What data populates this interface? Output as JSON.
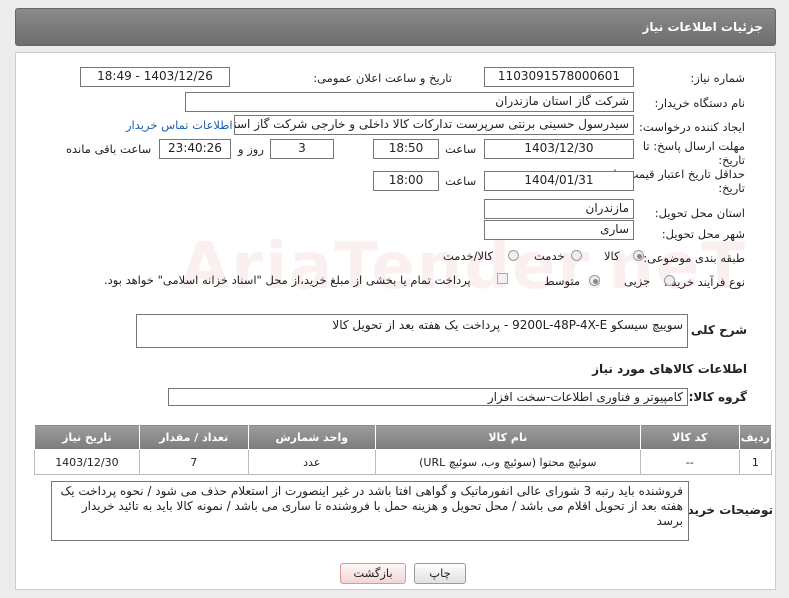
{
  "header": {
    "title": "جزئیات اطلاعات نیاز"
  },
  "form": {
    "need_number_label": "شماره نیاز:",
    "need_number": "1103091578000601",
    "announce_label": "تاریخ و ساعت اعلان عمومی:",
    "announce_value": "1403/12/26 - 18:49",
    "buyer_org_label": "نام دستگاه خریدار:",
    "buyer_org": "شرکت گاز استان مازندران",
    "requester_label": "ایجاد کننده درخواست:",
    "requester": "سیدرسول حسینی برنتی سرپرست تدارکات کالا داخلی و خارجی  شرکت گاز استان مازندران",
    "contact_link": "اطلاعات تماس خریدار",
    "reply_deadline_label_1": "مهلت ارسال پاسخ: تا",
    "reply_deadline_label_2": "تاریخ:",
    "reply_date": "1403/12/30",
    "time_label": "ساعت",
    "reply_time": "18:50",
    "days_value": "3",
    "days_label": "روز و",
    "remaining_time": "23:40:26",
    "remaining_label": "ساعت باقی مانده",
    "validity_label_1": "حداقل تاریخ اعتبار قیمت: تا",
    "validity_label_2": "تاریخ:",
    "validity_date": "1404/01/31",
    "validity_time": "18:00",
    "province_label": "استان محل تحویل:",
    "province": "مازندران",
    "city_label": "شهر محل تحویل:",
    "city": "ساری",
    "category_label": "طبقه بندی موضوعی:",
    "category_options": [
      "کالا",
      "خدمت",
      "کالا/خدمت"
    ],
    "process_label": "نوع فرآیند خرید :",
    "process_options": [
      "جزیی",
      "متوسط"
    ],
    "payment_note": "پرداخت تمام یا بخشی از مبلغ خرید،از محل \"اسناد خزانه اسلامی\" خواهد بود."
  },
  "summary": {
    "label": "شرح کلی نیاز:",
    "value": "سوییچ سیسکو 9200L-48P-4X-E - پرداخت یک هفته بعد از تحویل کالا"
  },
  "goods_section": {
    "title": "اطلاعات کالاهای مورد نیاز",
    "group_label": "گروه کالا:",
    "group_value": "کامپیوتر و فناوری اطلاعات-سخت افزار"
  },
  "table": {
    "headers": [
      "ردیف",
      "کد کالا",
      "نام کالا",
      "واحد شمارش",
      "تعداد / مقدار",
      "تاریخ نیاز"
    ],
    "rows": [
      [
        "1",
        "--",
        "سوئیچ محتوا (سوئیچ وب، سوئیچ URL)",
        "عدد",
        "7",
        "1403/12/30"
      ]
    ]
  },
  "buyer_notes": {
    "label": "توضیحات خریدار:",
    "value": "فروشنده باید رتبه 3 شورای عالی انفورماتیک و گواهی افتا باشد در غیر اینصورت از استعلام حذف می شود / نحوه پرداخت یک هفته بعد از تحویل اقلام می باشد / محل تحویل و هزینه حمل با فروشنده تا ساری می باشد / نمونه کالا باید به تائید خریدار برسد"
  },
  "buttons": {
    "print": "چاپ",
    "back": "بازگشت"
  },
  "watermark": "AriaTender.neT"
}
